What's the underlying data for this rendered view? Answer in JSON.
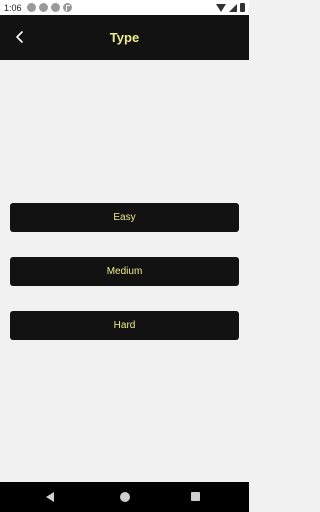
{
  "status_bar": {
    "time": "1:06",
    "icons": [
      "notification-dot-icon",
      "notification-dot-icon",
      "notification-dot-icon",
      "app-notification-icon",
      "wifi-icon",
      "signal-icon",
      "battery-icon"
    ]
  },
  "app_bar": {
    "title": "Type",
    "back_icon": "chevron-left-icon",
    "title_color": "#eceb8c",
    "background": "#121212"
  },
  "options": [
    {
      "label": "Easy"
    },
    {
      "label": "Medium"
    },
    {
      "label": "Hard"
    }
  ],
  "nav_bar": {
    "icons": [
      "back-triangle-icon",
      "home-circle-icon",
      "recents-square-icon"
    ]
  },
  "colors": {
    "page_background": "#f2f1f2",
    "button_background": "#121212",
    "button_text": "#eceb8c"
  }
}
